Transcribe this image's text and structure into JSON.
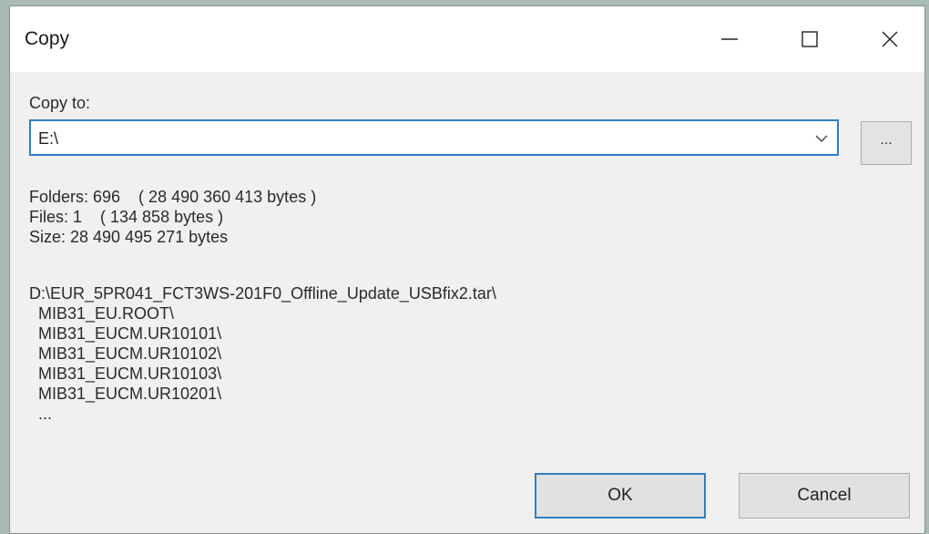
{
  "window": {
    "title": "Copy"
  },
  "copy_to": {
    "label": "Copy to:",
    "value": "E:\\",
    "browse_label": "..."
  },
  "stats": {
    "folders": "Folders: 696    ( 28 490 360 413 bytes )",
    "files": "Files: 1    ( 134 858 bytes )",
    "size": "Size: 28 490 495 271 bytes"
  },
  "paths": [
    "D:\\EUR_5PR041_FCT3WS-201F0_Offline_Update_USBfix2.tar\\",
    "  MIB31_EU.ROOT\\",
    "  MIB31_EUCM.UR10101\\",
    "  MIB31_EUCM.UR10102\\",
    "  MIB31_EUCM.UR10103\\",
    "  MIB31_EUCM.UR10201\\",
    "  ..."
  ],
  "buttons": {
    "ok": "OK",
    "cancel": "Cancel"
  }
}
